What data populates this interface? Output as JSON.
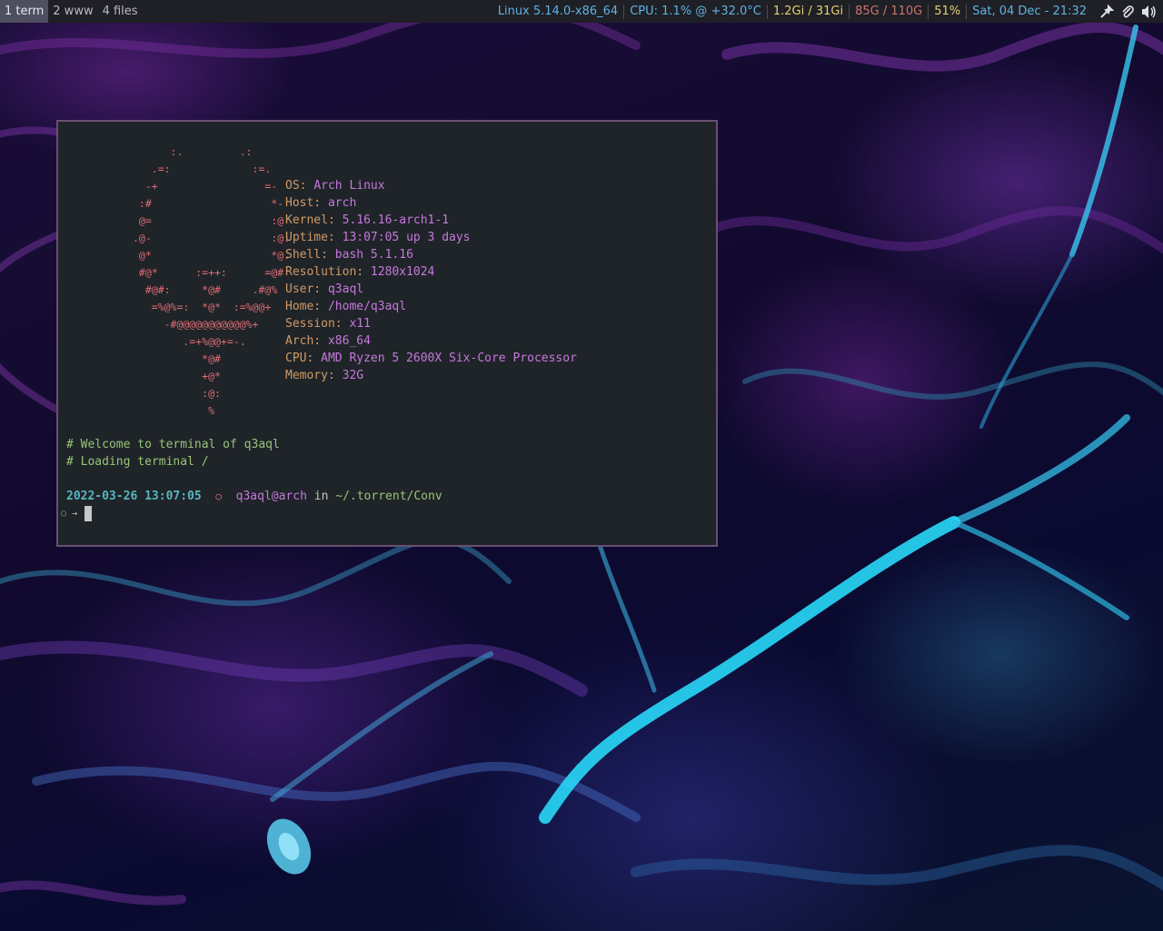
{
  "topbar": {
    "workspaces": [
      {
        "label": "1 term",
        "active": true
      },
      {
        "label": "2 www",
        "active": false
      },
      {
        "label": "4 files",
        "active": false
      }
    ],
    "kernel": "Linux 5.14.0-x86_64",
    "cpu": "CPU:  1.1% @ +32.0°C",
    "memory": "1.2Gi / 31Gi",
    "disk": "85G / 110G",
    "battery": "51%",
    "datetime": "Sat, 04 Dec - 21:32",
    "icons": [
      "tools-icon",
      "paperclip-icon",
      "speaker-icon"
    ],
    "colors": {
      "kernel": "#5fb3e0",
      "cpu": "#5fb3e0",
      "memory": "#e6d16a",
      "disk": "#c9766a",
      "battery": "#e6d16a",
      "datetime": "#5fb3e0"
    }
  },
  "terminal": {
    "ascii_art": "      :.         .:\n   .=:             :=.\n  -+                 =-\n :#                   *-\n @=                   :@\n.@-                   :@:\n @*                   *@.\n #@*      :=++:      =@#\n  #@#:     *@#     .#@%\n   =%@%=:  *@*  :=%@@+\n     -#@@@@@@@@@@@%+\n        .=+%@@+=-.\n           *@#\n           +@*\n           :@:\n            %",
    "info": [
      {
        "key": "OS: ",
        "value": "Arch Linux"
      },
      {
        "key": "Host: ",
        "value": "arch"
      },
      {
        "key": "Kernel: ",
        "value": "5.16.16-arch1-1"
      },
      {
        "key": "Uptime: ",
        "value": "13:07:05 up 3 days"
      },
      {
        "key": "Shell: ",
        "value": "bash 5.1.16"
      },
      {
        "key": "Resolution: ",
        "value": "1280x1024"
      },
      {
        "key": "User: ",
        "value": "q3aql"
      },
      {
        "key": "Home: ",
        "value": "/home/q3aql"
      },
      {
        "key": "Session: ",
        "value": "x11"
      },
      {
        "key": "Arch: ",
        "value": "x86_64"
      },
      {
        "key": "CPU: ",
        "value": "AMD Ryzen 5 2600X Six-Core Processor"
      },
      {
        "key": "Memory: ",
        "value": "32G"
      }
    ],
    "welcome": "# Welcome to terminal of q3aql",
    "loading": "# Loading terminal /",
    "prompt": {
      "timestamp": "2022-03-26 13:07:05",
      "dot": "○",
      "user": "q3aql@arch",
      "in": " in ",
      "path": "~/.torrent/Conv"
    },
    "cmd_prefix": "○",
    "cmd_arrow": "→"
  }
}
